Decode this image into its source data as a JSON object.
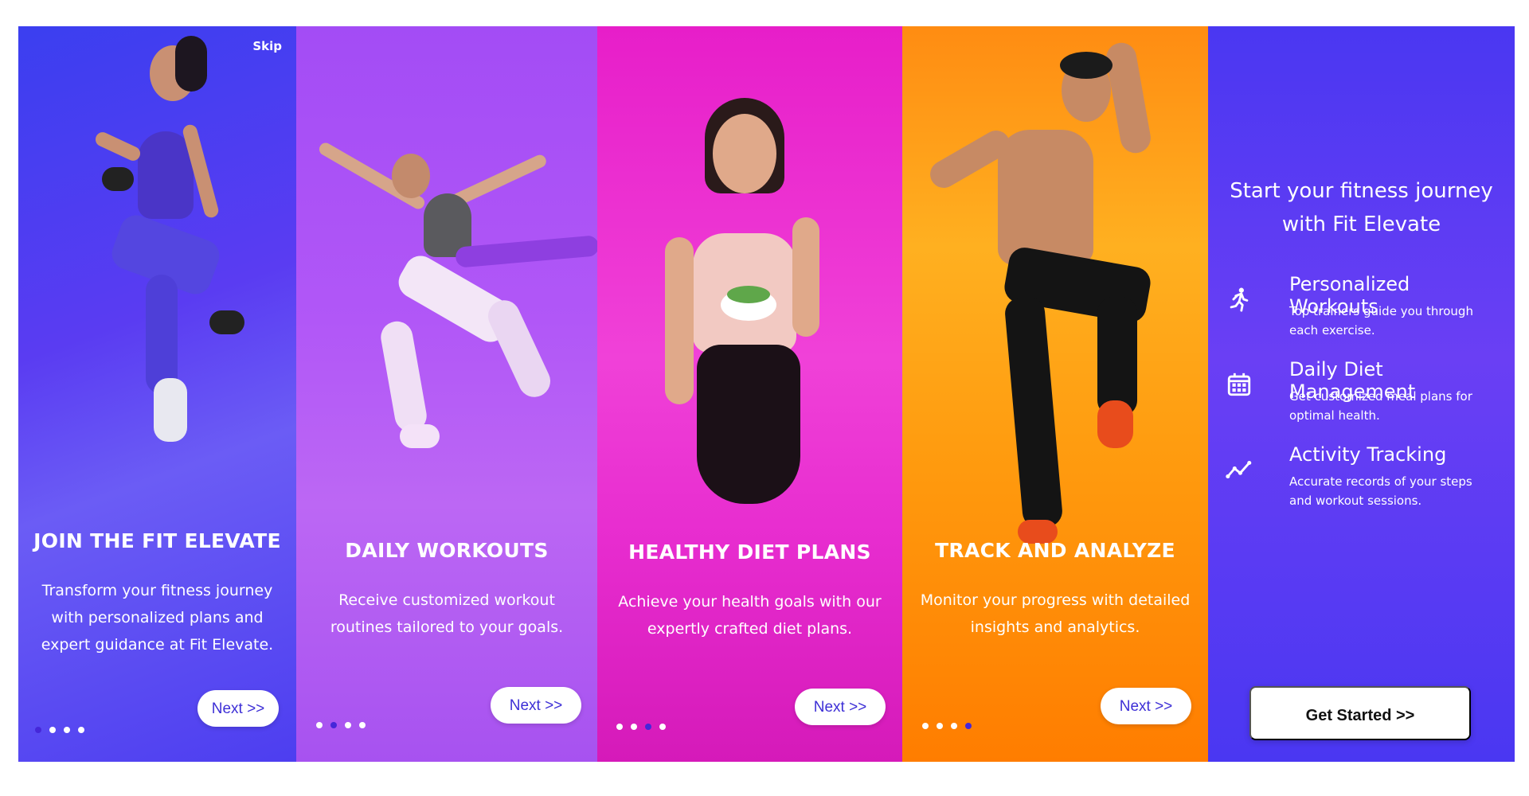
{
  "colors": {
    "panel1": "#4a3ef0",
    "panel2": "#ad52f6",
    "panel3": "#e72ccf",
    "panel4": "#ff9a0e",
    "panel5": "#5a3bf3",
    "button_text": "#3d2fd6",
    "active_dot": "#4527d9"
  },
  "screens": [
    {
      "skip": "Skip",
      "title": "JOIN THE FIT ELEVATE",
      "description": "Transform your fitness journey with personalized plans and expert guidance at Fit Elevate.",
      "next": "Next >>",
      "active_dot": 1
    },
    {
      "title": "DAILY WORKOUTS",
      "description": "Receive customized workout routines tailored to your goals.",
      "next": "Next >>",
      "active_dot": 2
    },
    {
      "title": "HEALTHY DIET PLANS",
      "description": "Achieve your health goals with our expertly crafted diet plans.",
      "next": "Next >>",
      "active_dot": 3
    },
    {
      "title": "TRACK AND ANALYZE",
      "description": "Monitor your progress with detailed insights and analytics.",
      "next": "Next >>",
      "active_dot": 4
    }
  ],
  "final": {
    "intro": "Start your fitness journey with Fit Elevate",
    "features": [
      {
        "icon": "runner-icon",
        "title": "Personalized Workouts",
        "description": "Top trainers guide you through each exercise."
      },
      {
        "icon": "calendar-icon",
        "title": "Daily Diet Management",
        "description": "Get customized meal plans for optimal health."
      },
      {
        "icon": "trend-line-icon",
        "title": "Activity Tracking",
        "description": "Accurate records of your steps and workout sessions."
      }
    ],
    "cta": "Get Started >>"
  }
}
